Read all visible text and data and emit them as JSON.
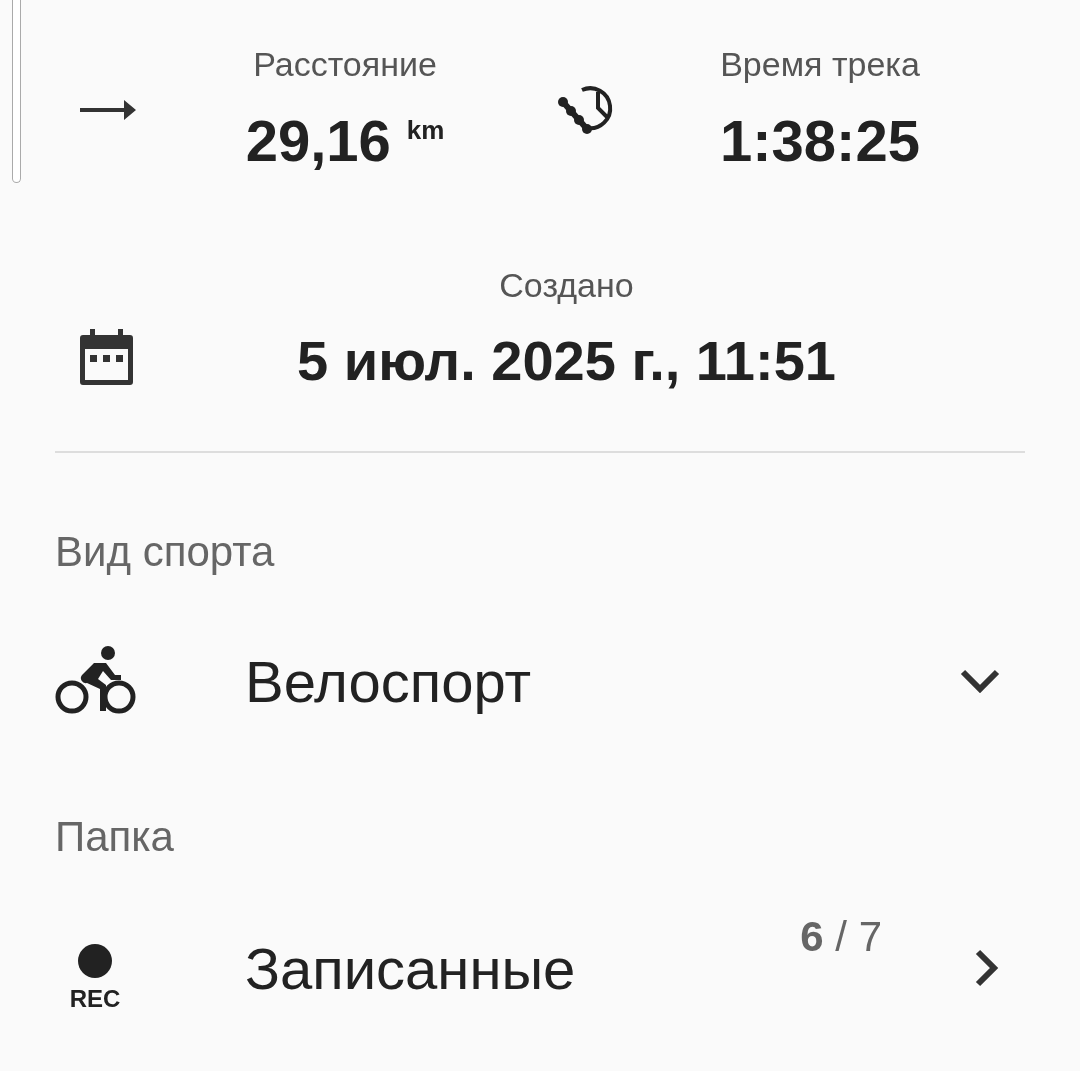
{
  "stats": [
    {
      "kind": "distance",
      "label": "Расстояние",
      "value": "29,16",
      "unit": "km"
    },
    {
      "kind": "duration",
      "label": "Время трека",
      "value": "1:38:25"
    }
  ],
  "created": {
    "label": "Создано",
    "value": "5 июл. 2025 г., 11:51"
  },
  "sport": {
    "label": "Вид спорта",
    "value": "Велоспорт"
  },
  "folder": {
    "label": "Папка",
    "icon_text": "REC",
    "value": "Записанные",
    "count": "**6** / 7"
  }
}
